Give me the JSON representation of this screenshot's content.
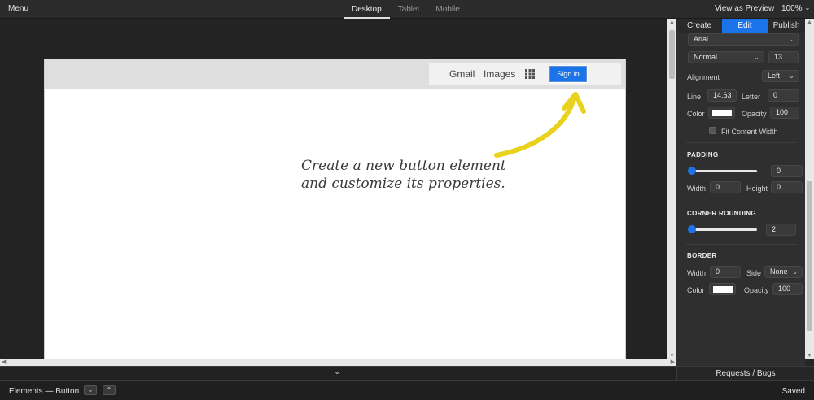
{
  "topbar": {
    "menu_label": "Menu",
    "device_tabs": [
      {
        "label": "Desktop",
        "active": true
      },
      {
        "label": "Tablet",
        "active": false
      },
      {
        "label": "Mobile",
        "active": false
      }
    ],
    "view_preview_label": "View as Preview",
    "zoom_value": "100%"
  },
  "canvas": {
    "nav": {
      "gmail": "Gmail",
      "images": "Images",
      "apps_icon": "apps-grid-icon",
      "signin": "Sign in"
    },
    "callout": {
      "line1": "Create a new button element",
      "line2": "and customize its properties.",
      "arrow_color": "#e8d21e"
    }
  },
  "panel": {
    "tabs": [
      {
        "label": "Create",
        "active": false
      },
      {
        "label": "Edit",
        "active": true
      },
      {
        "label": "Publish",
        "active": false
      }
    ],
    "font_family": "Arial",
    "font_weight": "Normal",
    "font_size": "13",
    "alignment_label": "Alignment",
    "alignment_value": "Left",
    "line_label": "Line",
    "line_value": "14.63",
    "letter_label": "Letter",
    "letter_value": "0",
    "color_label": "Color",
    "color_value": "#ffffff",
    "opacity_label": "Opacity",
    "opacity_value": "100",
    "fit_content_label": "Fit Content Width",
    "padding": {
      "title": "PADDING",
      "value": "0",
      "level": 0,
      "width_label": "Width",
      "width_value": "0",
      "height_label": "Height",
      "height_value": "0"
    },
    "corner_rounding": {
      "title": "CORNER ROUNDING",
      "value": "2",
      "level": 0
    },
    "border": {
      "title": "BORDER",
      "width_label": "Width",
      "width_value": "0",
      "side_label": "Side",
      "side_value": "None",
      "color_label": "Color",
      "color_value": "#ffffff",
      "opacity_label": "Opacity",
      "opacity_value": "100"
    }
  },
  "bottom": {
    "requests_label": "Requests / Bugs",
    "breadcrumb": "Elements — Button",
    "saved_label": "Saved"
  },
  "colors": {
    "accent": "#1a73e8",
    "panel_bg": "#2f2f2f",
    "canvas_bg": "#232323"
  }
}
